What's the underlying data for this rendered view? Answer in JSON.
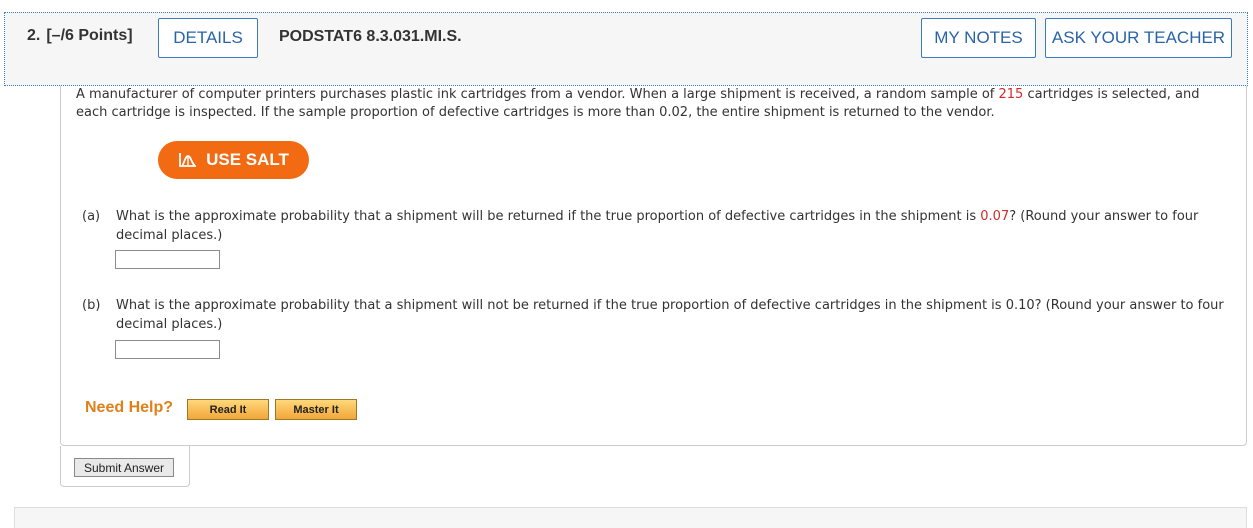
{
  "header": {
    "question_number": "2.",
    "points": "[–/6 Points]",
    "details_label": "DETAILS",
    "problem_code": "PODSTAT6 8.3.031.MI.S.",
    "my_notes_label": "MY NOTES",
    "ask_teacher_label": "ASK YOUR TEACHER"
  },
  "problem": {
    "text_1": "A manufacturer of computer printers purchases plastic ink cartridges from a vendor. When a large shipment is received, a random sample of ",
    "sample_size": "215",
    "text_2": " cartridges is selected, and each cartridge is inspected. If the sample proportion of defective cartridges is more than 0.02, the entire shipment is returned to the vendor."
  },
  "salt": {
    "label": "USE SALT",
    "icon": "salt-chart-icon",
    "color": "#f26a12"
  },
  "parts": [
    {
      "label": "(a)",
      "text_1": "What is the approximate probability that a shipment will be returned if the true proportion of defective cartridges in the shipment is ",
      "value": "0.07",
      "text_2": "? (Round your answer to four decimal places.)",
      "answer": ""
    },
    {
      "label": "(b)",
      "text": "What is the approximate probability that a shipment will not be returned if the true proportion of defective cartridges in the shipment is 0.10? (Round your answer to four decimal places.)",
      "answer": ""
    }
  ],
  "help": {
    "need_help_label": "Need Help?",
    "read_it_label": "Read It",
    "master_it_label": "Master It"
  },
  "submit": {
    "label": "Submit Answer"
  },
  "colors": {
    "accent_blue": "#2a64a8",
    "highlight_red": "#d42a2a",
    "help_orange": "#e0801a"
  }
}
